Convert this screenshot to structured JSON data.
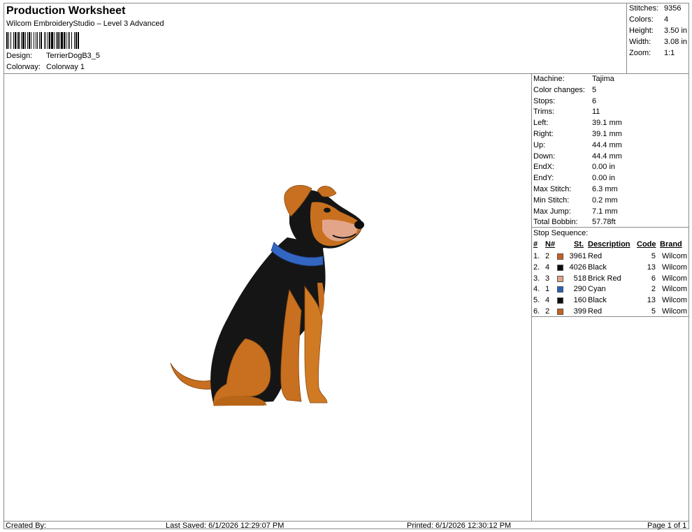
{
  "header": {
    "title": "Production Worksheet",
    "subtitle": "Wilcom EmbroideryStudio – Level 3 Advanced",
    "design_label": "Design:",
    "design_value": "TerrierDogB3_5",
    "colorway_label": "Colorway:",
    "colorway_value": "Colorway 1"
  },
  "summary": [
    {
      "k": "Stitches:",
      "v": "9356"
    },
    {
      "k": "Colors:",
      "v": "4"
    },
    {
      "k": "Height:",
      "v": "3.50 in"
    },
    {
      "k": "Width:",
      "v": "3.08 in"
    },
    {
      "k": "Zoom:",
      "v": "1:1"
    }
  ],
  "info": [
    {
      "k": "Machine:",
      "v": "Tajima"
    },
    {
      "k": "Color changes:",
      "v": "5"
    },
    {
      "k": "Stops:",
      "v": "6"
    },
    {
      "k": "Trims:",
      "v": "11"
    },
    {
      "k": "Left:",
      "v": "39.1 mm"
    },
    {
      "k": "Right:",
      "v": "39.1 mm"
    },
    {
      "k": "Up:",
      "v": "44.4 mm"
    },
    {
      "k": "Down:",
      "v": "44.4 mm"
    },
    {
      "k": "EndX:",
      "v": "0.00 in"
    },
    {
      "k": "EndY:",
      "v": "0.00 in"
    },
    {
      "k": "Max Stitch:",
      "v": "6.3 mm"
    },
    {
      "k": "Min Stitch:",
      "v": "0.2 mm"
    },
    {
      "k": "Max Jump:",
      "v": "7.1 mm"
    },
    {
      "k": "Total Bobbin:",
      "v": "57.78ft"
    }
  ],
  "stop_sequence": {
    "title": "Stop Sequence:",
    "headers": {
      "num": "#",
      "n": "N#",
      "st": "St.",
      "desc": "Description",
      "code": "Code",
      "brand": "Brand"
    },
    "rows": [
      {
        "num": "1.",
        "n": "2",
        "color": "#c8601e",
        "st": "3961",
        "desc": "Red",
        "code": "5",
        "brand": "Wilcom"
      },
      {
        "num": "2.",
        "n": "4",
        "color": "#0d0d0d",
        "st": "4026",
        "desc": "Black",
        "code": "13",
        "brand": "Wilcom"
      },
      {
        "num": "3.",
        "n": "3",
        "color": "#e3a58a",
        "st": "518",
        "desc": "Brick Red",
        "code": "6",
        "brand": "Wilcom"
      },
      {
        "num": "4.",
        "n": "1",
        "color": "#2c5fb8",
        "st": "290",
        "desc": "Cyan",
        "code": "2",
        "brand": "Wilcom"
      },
      {
        "num": "5.",
        "n": "4",
        "color": "#0d0d0d",
        "st": "160",
        "desc": "Black",
        "code": "13",
        "brand": "Wilcom"
      },
      {
        "num": "6.",
        "n": "2",
        "color": "#c8601e",
        "st": "399",
        "desc": "Red",
        "code": "5",
        "brand": "Wilcom"
      }
    ]
  },
  "footer": {
    "created": "Created By:",
    "saved": "Last Saved: 6/1/2026 12:29:07 PM",
    "printed": "Printed: 6/1/2026 12:30:12 PM",
    "page": "Page 1 of 1"
  }
}
